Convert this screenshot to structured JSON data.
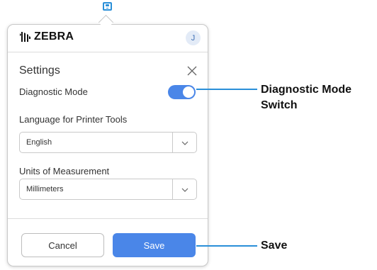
{
  "header": {
    "logo_text": "ZEBRA",
    "avatar_initial": "J"
  },
  "settings": {
    "title": "Settings",
    "diagnostic_mode": {
      "label": "Diagnostic Mode",
      "enabled": true
    },
    "language": {
      "label": "Language for Printer Tools",
      "value": "English"
    },
    "units": {
      "label": "Units of Measurement",
      "value": "Millimeters"
    }
  },
  "buttons": {
    "cancel": "Cancel",
    "save": "Save"
  },
  "callouts": {
    "diagnostic_line1": "Diagnostic Mode",
    "diagnostic_line2": "Switch",
    "save": "Save"
  },
  "colors": {
    "accent": "#4a86e8",
    "callout_line": "#2a8fd8"
  },
  "icons": {
    "tray": "printer-tray-icon",
    "logo": "zebra-head-icon",
    "close": "close-icon",
    "dropdown": "chevron-down-icon"
  }
}
